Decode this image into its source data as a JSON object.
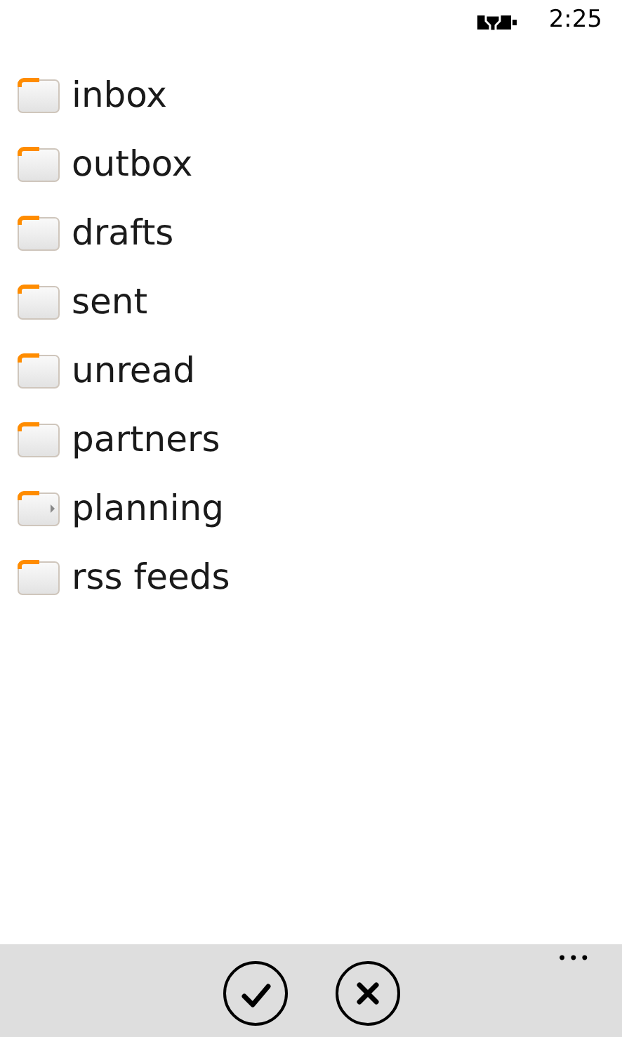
{
  "status_bar": {
    "time": "2:25"
  },
  "folders": [
    {
      "label": "inbox",
      "kind": "folder"
    },
    {
      "label": "outbox",
      "kind": "folder"
    },
    {
      "label": "drafts",
      "kind": "folder"
    },
    {
      "label": "sent",
      "kind": "folder"
    },
    {
      "label": "unread",
      "kind": "folder"
    },
    {
      "label": "partners",
      "kind": "folder"
    },
    {
      "label": "planning",
      "kind": "parent"
    },
    {
      "label": "rss feeds",
      "kind": "folder"
    }
  ],
  "app_bar": {
    "buttons": [
      {
        "kind": "ok"
      },
      {
        "kind": "cancel"
      }
    ],
    "more": "•••"
  }
}
